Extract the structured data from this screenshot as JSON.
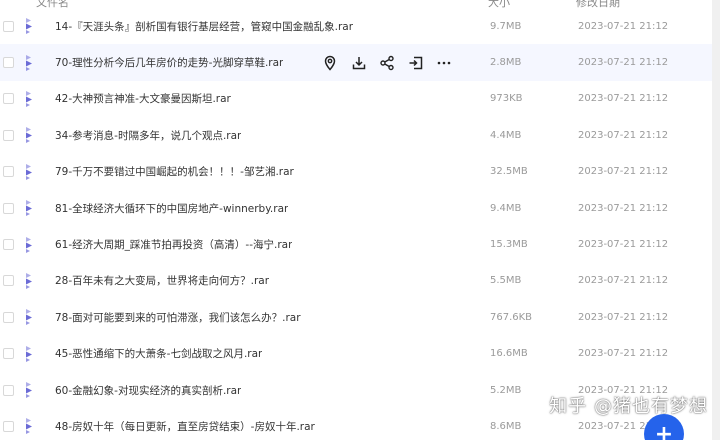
{
  "header": {
    "name_label": "文件名",
    "size_label": "大小",
    "date_label": "修改日期"
  },
  "files": [
    {
      "name": "14-『天涯头条』剖析国有银行基层经营，管窥中国金融乱象.rar",
      "size": "9.7MB",
      "date": "2023-07-21 21:12"
    },
    {
      "name": "70-理性分析今后几年房价的走势-光脚穿草鞋.rar",
      "size": "2.8MB",
      "date": "2023-07-21 21:12"
    },
    {
      "name": "42-大神预言神准-大文豪曼因斯坦.rar",
      "size": "973KB",
      "date": "2023-07-21 21:12"
    },
    {
      "name": "34-参考消息-时隔多年，说几个观点.rar",
      "size": "4.4MB",
      "date": "2023-07-21 21:12"
    },
    {
      "name": "79-千万不要错过中国崛起的机会！！！-邹艺湘.rar",
      "size": "32.5MB",
      "date": "2023-07-21 21:12"
    },
    {
      "name": "81-全球经济大循环下的中国房地产-winnerby.rar",
      "size": "9.4MB",
      "date": "2023-07-21 21:12"
    },
    {
      "name": "61-经济大周期_踩准节拍再投资（高清）--海宁.rar",
      "size": "15.3MB",
      "date": "2023-07-21 21:12"
    },
    {
      "name": "28-百年未有之大变局，世界将走向何方？.rar",
      "size": "5.5MB",
      "date": "2023-07-21 21:12"
    },
    {
      "name": "78-面对可能要到来的可怕滞涨，我们该怎么办？.rar",
      "size": "767.6KB",
      "date": "2023-07-21 21:12"
    },
    {
      "name": "45-恶性通缩下的大萧条-七剑战取之风月.rar",
      "size": "16.6MB",
      "date": "2023-07-21 21:12"
    },
    {
      "name": "60-金融幻象-对现实经济的真实剖析.rar",
      "size": "5.2MB",
      "date": "2023-07-21 21:12"
    },
    {
      "name": "48-房奴十年（每日更新，直至房贷结束）-房奴十年.rar",
      "size": "8.6MB",
      "date": "2023-07-21 21:12"
    }
  ],
  "row_actions": [
    {
      "icon": "location-pin-icon"
    },
    {
      "icon": "download-icon"
    },
    {
      "icon": "share-icon"
    },
    {
      "icon": "move-icon"
    },
    {
      "icon": "more-icon"
    }
  ],
  "watermark": "知乎 @猪也有梦想",
  "fab_label": "+",
  "colors": {
    "accent": "#2563eb",
    "hover_row": "#f5f7ff",
    "file_icon": "#6b6bd6"
  }
}
